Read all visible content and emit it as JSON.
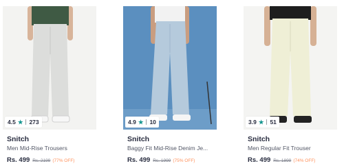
{
  "products": [
    {
      "brand": "Snitch",
      "name": "Men Mid-Rise Trousers",
      "rating": "4.5",
      "rating_count": "273",
      "price": "Rs. 499",
      "mrp": "Rs. 2199",
      "discount": "(77% OFF)",
      "image_bg": "#f3f3f1",
      "garment_color": "#dcdddb",
      "shirt_color": "#3f5a44"
    },
    {
      "brand": "Snitch",
      "name": "Baggy Fit Mid-Rise Denim Je...",
      "rating": "4.9",
      "rating_count": "10",
      "price": "Rs. 499",
      "mrp": "Rs. 1999",
      "discount": "(75% OFF)",
      "image_bg": "#5b8fbf",
      "garment_color": "#b5cadc",
      "shirt_color": "#f2f2f2"
    },
    {
      "brand": "Snitch",
      "name": "Men Regular Fit Trouser",
      "rating": "3.9",
      "rating_count": "51",
      "price": "Rs. 499",
      "mrp": "Rs. 1899",
      "discount": "(74% OFF)",
      "image_bg": "#f4f4f2",
      "garment_color": "#efefd6",
      "shirt_color": "#1e1e1e"
    }
  ],
  "icons": {
    "rating_star": "star-icon"
  },
  "colors": {
    "star": "#14958f",
    "discount": "#ff905a",
    "text": "#282c3f"
  }
}
